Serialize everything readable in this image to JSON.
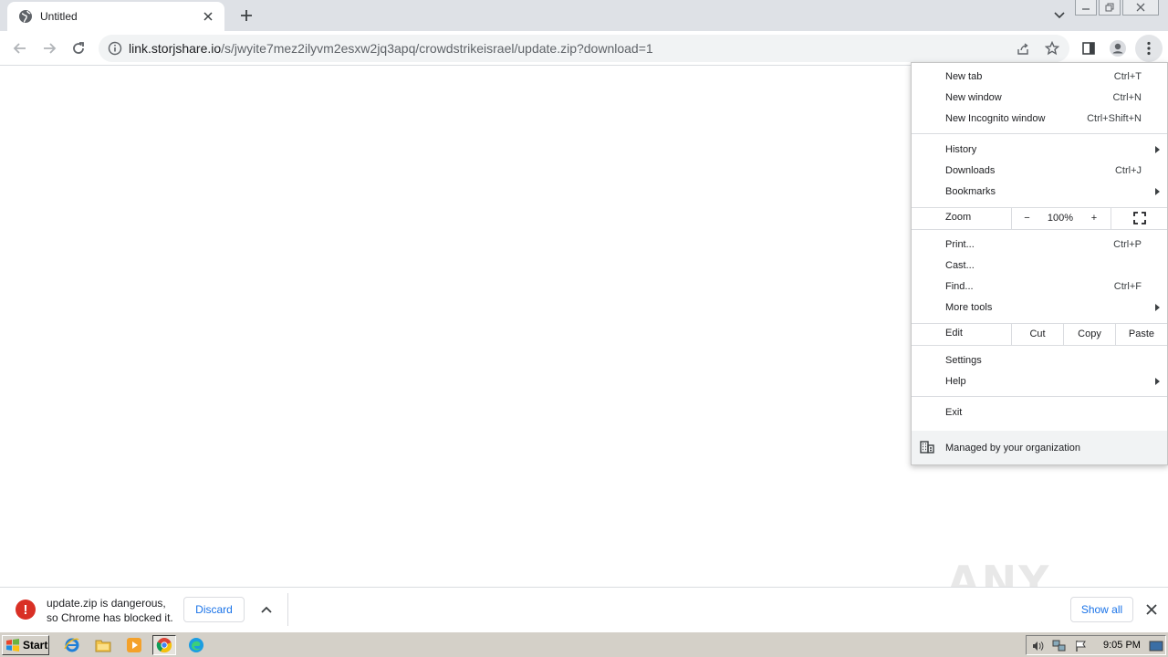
{
  "tab": {
    "title": "Untitled"
  },
  "omnibox": {
    "url_host": "link.storjshare.io",
    "url_path": "/s/jwyite7mez2ilyvm2esxw2jq3apq/crowdstrikeisrael/update.zip?download=1"
  },
  "menu": {
    "new_tab": {
      "label": "New tab",
      "shortcut": "Ctrl+T"
    },
    "new_window": {
      "label": "New window",
      "shortcut": "Ctrl+N"
    },
    "new_incognito": {
      "label": "New Incognito window",
      "shortcut": "Ctrl+Shift+N"
    },
    "history": {
      "label": "History"
    },
    "downloads": {
      "label": "Downloads",
      "shortcut": "Ctrl+J"
    },
    "bookmarks": {
      "label": "Bookmarks"
    },
    "zoom": {
      "label": "Zoom",
      "minus": "−",
      "value": "100%",
      "plus": "+"
    },
    "print": {
      "label": "Print...",
      "shortcut": "Ctrl+P"
    },
    "cast": {
      "label": "Cast..."
    },
    "find": {
      "label": "Find...",
      "shortcut": "Ctrl+F"
    },
    "more_tools": {
      "label": "More tools"
    },
    "edit": {
      "label": "Edit",
      "cut": "Cut",
      "copy": "Copy",
      "paste": "Paste"
    },
    "settings": {
      "label": "Settings"
    },
    "help": {
      "label": "Help"
    },
    "exit": {
      "label": "Exit"
    },
    "managed": {
      "label": "Managed by your organization"
    }
  },
  "download_shelf": {
    "line1": "update.zip is dangerous,",
    "line2": "so Chrome has blocked it.",
    "discard": "Discard",
    "show_all": "Show all"
  },
  "watermark": "ANY RUN",
  "taskbar": {
    "start": "Start",
    "clock": "9:05 PM"
  },
  "colors": {
    "danger": "#d93025",
    "link_blue": "#1a73e8",
    "tabstrip": "#dee1e6"
  }
}
